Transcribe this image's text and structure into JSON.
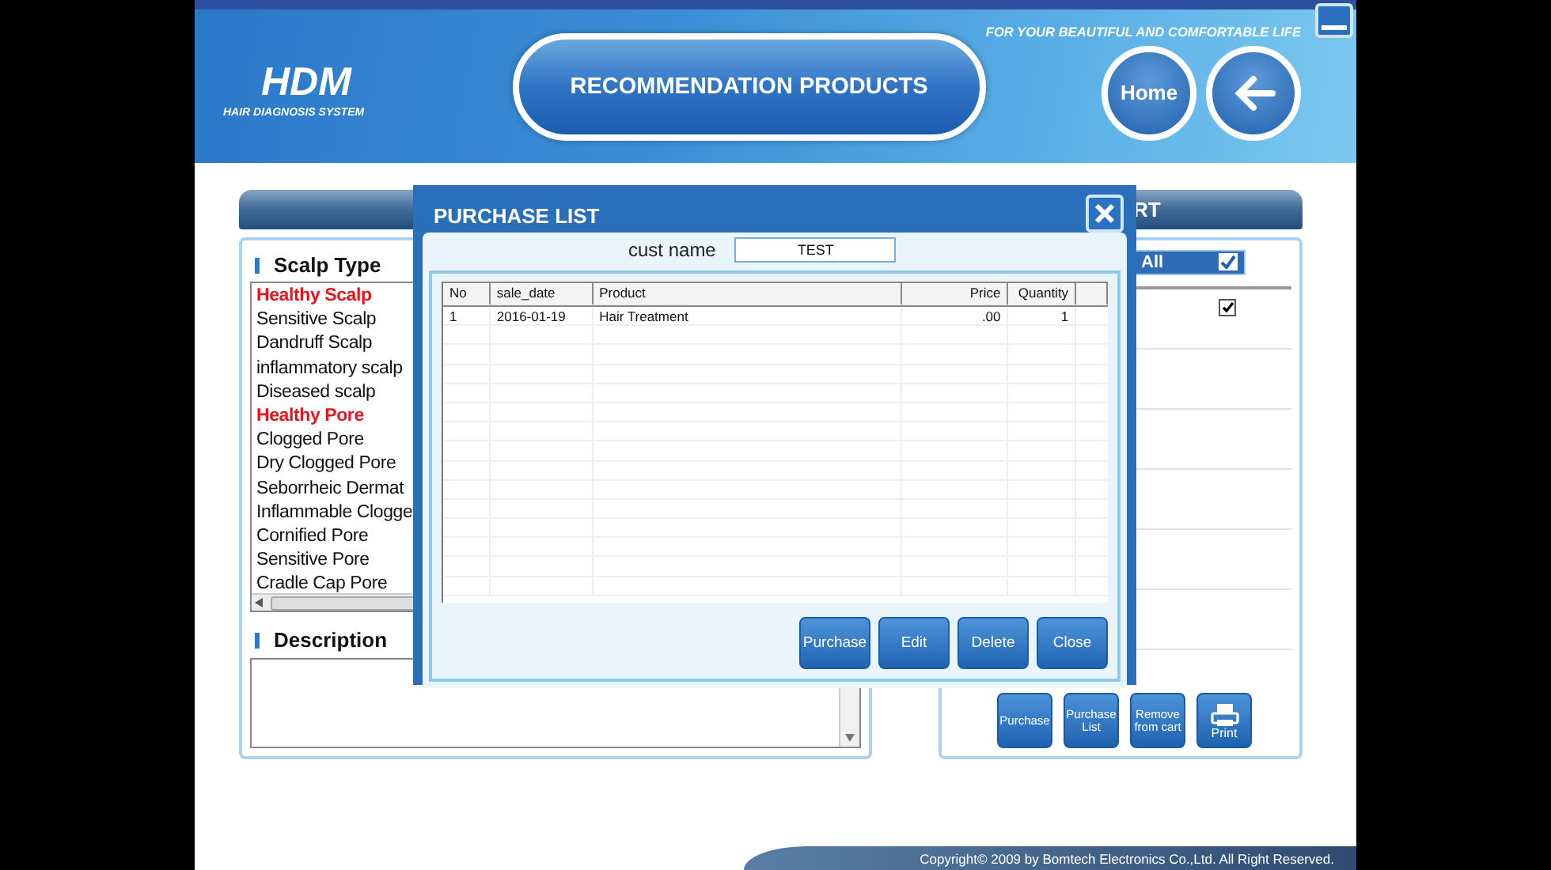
{
  "header": {
    "logo": "HDM",
    "logo_subtitle": "HAIR DIAGNOSIS SYSTEM",
    "tagline": "FOR YOUR BEAUTIFUL AND COMFORTABLE LIFE",
    "title": "RECOMMENDATION PRODUCTS",
    "home_button": "Home"
  },
  "scalp_panel": {
    "label": "Scalp Type",
    "items": [
      {
        "text": "Healthy Scalp",
        "highlighted": true
      },
      {
        "text": "Sensitive Scalp",
        "highlighted": false
      },
      {
        "text": "Dandruff Scalp",
        "highlighted": false
      },
      {
        "text": "inflammatory scalp",
        "highlighted": false
      },
      {
        "text": "Diseased scalp",
        "highlighted": false
      },
      {
        "text": "Healthy Pore",
        "highlighted": true
      },
      {
        "text": "Clogged Pore",
        "highlighted": false
      },
      {
        "text": "Dry Clogged Pore",
        "highlighted": false
      },
      {
        "text": "Seborrheic Dermat",
        "highlighted": false
      },
      {
        "text": "Inflammable Clogge",
        "highlighted": false
      },
      {
        "text": "Cornified Pore",
        "highlighted": false
      },
      {
        "text": "Sensitive Pore",
        "highlighted": false
      },
      {
        "text": "Cradle Cap Pore",
        "highlighted": false
      }
    ],
    "description_label": "Description"
  },
  "cart_panel": {
    "title": "RT",
    "select_all": {
      "label": "All",
      "checked": true
    },
    "rows": [
      {
        "checked": true
      }
    ],
    "buttons": [
      {
        "label": "Purchase",
        "kind": "text"
      },
      {
        "label": "Purchase List",
        "kind": "text"
      },
      {
        "label": "Remove from cart",
        "kind": "text"
      },
      {
        "label": "Print",
        "kind": "print"
      }
    ]
  },
  "dialog": {
    "title": "PURCHASE LIST",
    "cust_name_label": "cust name",
    "cust_name": "TEST",
    "columns": [
      "No",
      "sale_date",
      "Product",
      "Price",
      "Quantity"
    ],
    "rows": [
      [
        "1",
        "2016-01-19",
        "Hair Treatment",
        ".00",
        "1"
      ]
    ],
    "buttons": [
      "Purchase",
      "Edit",
      "Delete",
      "Close"
    ]
  },
  "footer": {
    "copyright": "Copyright© 2009 by Bomtech Electronics Co.,Ltd.  All Right Reserved."
  }
}
